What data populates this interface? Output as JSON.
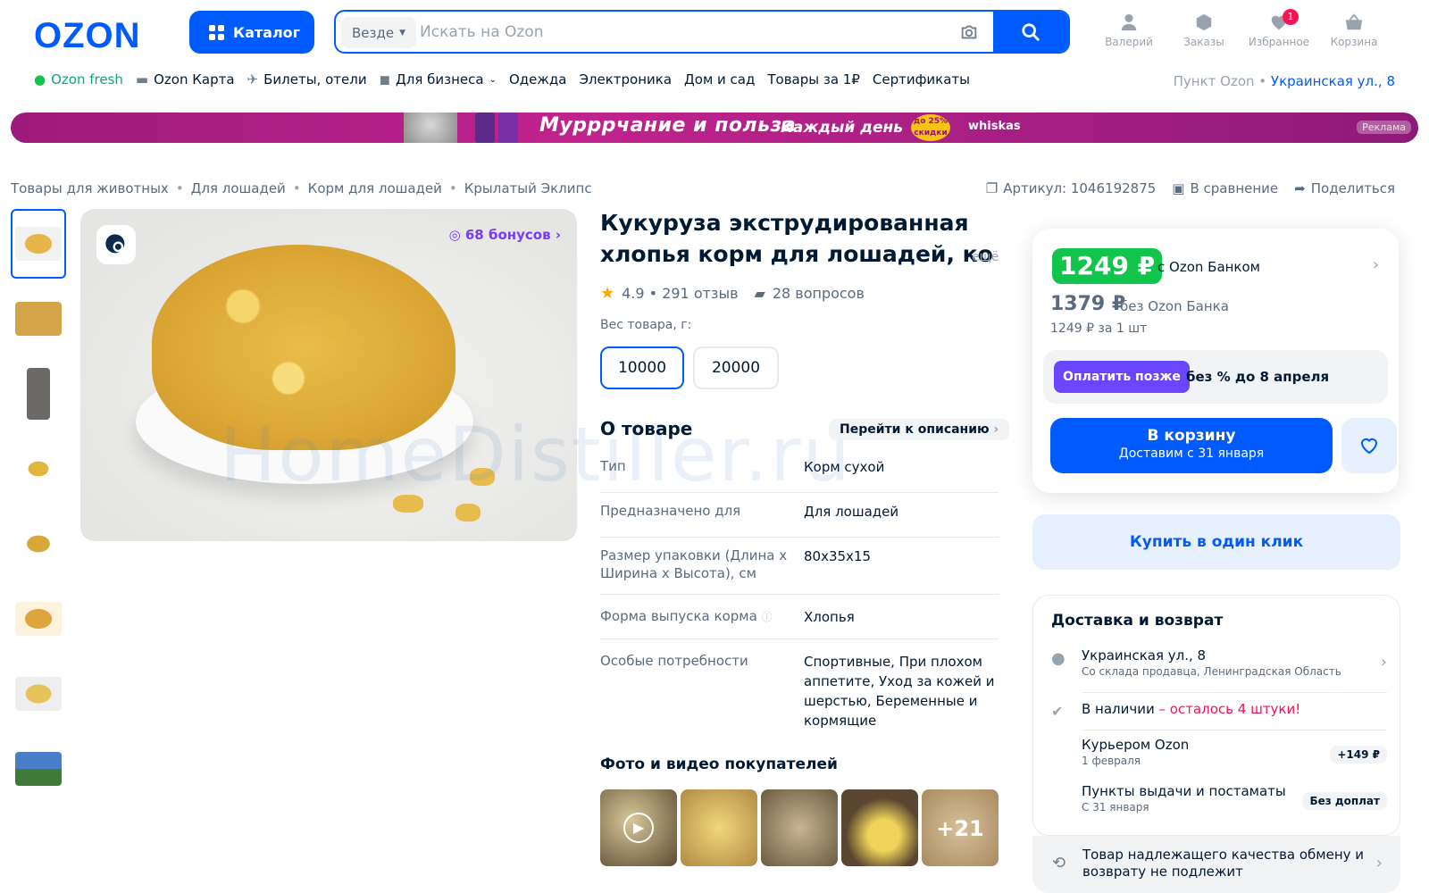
{
  "header": {
    "logo": "OZON",
    "catalog": "Каталог",
    "search_scope": "Везде",
    "search_placeholder": "Искать на Ozon",
    "user": "Валерий",
    "orders": "Заказы",
    "favorites": "Избранное",
    "favorites_count": "1",
    "cart": "Корзина"
  },
  "nav": {
    "items": [
      "Ozon fresh",
      "Ozon Карта",
      "Билеты, отели",
      "Для бизнеса",
      "Одежда",
      "Электроника",
      "Дом и сад",
      "Товары за 1₽",
      "Сертификаты"
    ],
    "pickup_label": "Пункт Ozon •",
    "pickup_address": "Украинская ул., 8"
  },
  "banner": {
    "text": "Мурррчание и польза",
    "text2": "Каждый день",
    "discount": "до 25% скидки",
    "brand": "whiskas",
    "ad": "Реклама"
  },
  "breadcrumbs": [
    "Товары для животных",
    "Для лошадей",
    "Корм для лошадей",
    "Крылатый Эклипс"
  ],
  "actions": {
    "article": "Артикул: 1046192875",
    "compare": "В сравнение",
    "share": "Поделиться"
  },
  "product": {
    "bonus": "68 бонусов",
    "title": "Кукуруза экструдированная хлопья корм для лошадей, ко",
    "more": "ещё",
    "rating": "4.9 • 291 отзыв",
    "questions": "28 вопросов",
    "weight_label": "Вес товара, г:",
    "weights": [
      "10000",
      "20000"
    ],
    "about_title": "О товаре",
    "goto_desc": "Перейти к описанию",
    "specs": [
      {
        "k": "Тип",
        "v": "Корм сухой"
      },
      {
        "k": "Предназначено для",
        "v": "Для лошадей"
      },
      {
        "k": "Размер упаковки (Длина х Ширина х Высота), см",
        "v": "80x35x15"
      },
      {
        "k": "Форма выпуска корма",
        "v": "Хлопья"
      },
      {
        "k": "Особые потребности",
        "v": "Спортивные, При плохом аппетите, Уход за кожей и шерстью, Беременные и кормящие"
      }
    ],
    "photos_title": "Фото и видео покупателей",
    "photos_more": "+21"
  },
  "buy": {
    "price": "1249 ₽",
    "with_bank": "с Ozon Банком",
    "old_price": "1379 ₽",
    "without_bank": "без Ozon Банка",
    "per_unit": "1249 ₽ за 1 шт",
    "pay_later": "Оплатить позже",
    "pay_later_text": "без % до 8 апреля",
    "cart_line1": "В корзину",
    "cart_line2": "Доставим с 31 января",
    "one_click": "Купить в один клик"
  },
  "delivery": {
    "title": "Доставка и возврат",
    "address": "Украинская ул., 8",
    "address_sub": "Со склада продавца, Ленинградская Область",
    "stock": "В наличии",
    "stock_left": " – осталось 4 штуки!",
    "courier": "Курьером Ozon",
    "courier_date": "1 февраля",
    "courier_price": "+149 ₽",
    "points": "Пункты выдачи и постаматы",
    "points_date": "С 31 января",
    "points_price": "Без доплат",
    "quality": "Товар надлежащего качества обмену и возврату не подлежит"
  },
  "watermark": "HomeDistiller.ru",
  "colors": {
    "accent": "#005bff",
    "price_green": "#10c44c",
    "pay_violet": "#6b46ff",
    "alert": "#f91155"
  }
}
